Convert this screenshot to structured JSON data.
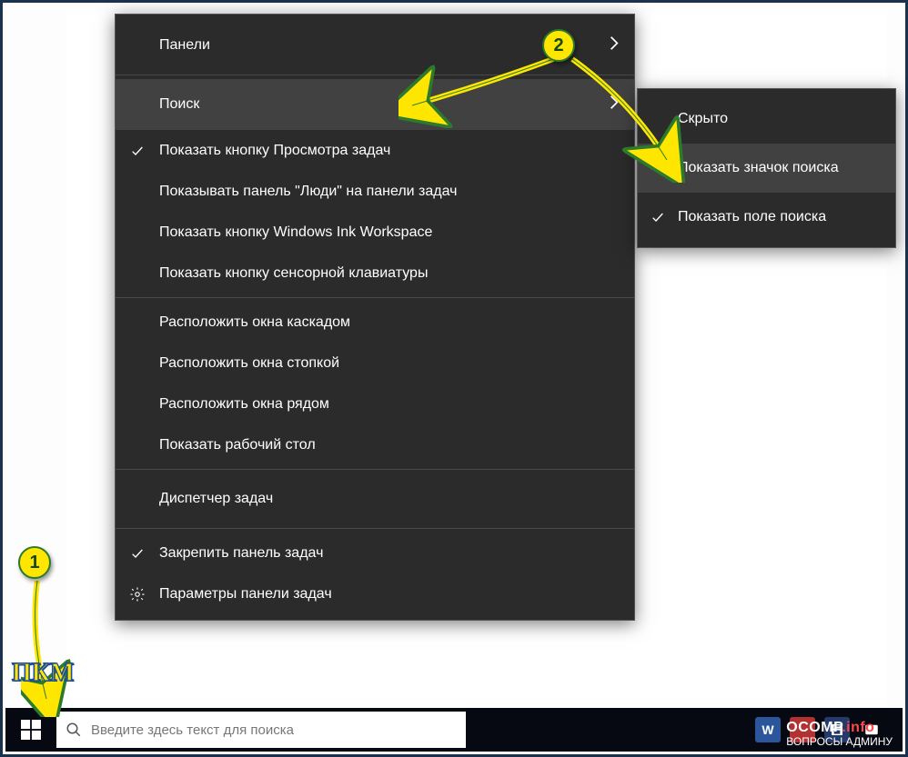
{
  "annotations": {
    "badge1": "1",
    "badge2": "2",
    "pkm": "ПКМ"
  },
  "context_menu": {
    "items": [
      {
        "label": "Панели",
        "has_submenu": true
      },
      {
        "label": "Поиск",
        "has_submenu": true,
        "hovered": true
      },
      {
        "label": "Показать кнопку Просмотра задач",
        "checked": true
      },
      {
        "label": "Показывать панель \"Люди\" на панели задач"
      },
      {
        "label": "Показать кнопку Windows Ink Workspace"
      },
      {
        "label": "Показать кнопку сенсорной клавиатуры"
      },
      {
        "label": "Расположить окна каскадом"
      },
      {
        "label": "Расположить окна стопкой"
      },
      {
        "label": "Расположить окна рядом"
      },
      {
        "label": "Показать рабочий стол"
      },
      {
        "label": "Диспетчер задач"
      },
      {
        "label": "Закрепить панель задач",
        "checked": true
      },
      {
        "label": "Параметры панели задач",
        "icon": "gear"
      }
    ]
  },
  "submenu": {
    "items": [
      {
        "label": "Скрыто"
      },
      {
        "label": "Показать значок поиска",
        "hovered": true
      },
      {
        "label": "Показать поле поиска",
        "checked": true
      }
    ]
  },
  "taskbar": {
    "search_placeholder": "Введите здесь текст для поиска"
  },
  "watermark": {
    "line1_a": "OCOMP",
    "line1_b": ".info",
    "line2": "ВОПРОСЫ АДМИНУ"
  }
}
